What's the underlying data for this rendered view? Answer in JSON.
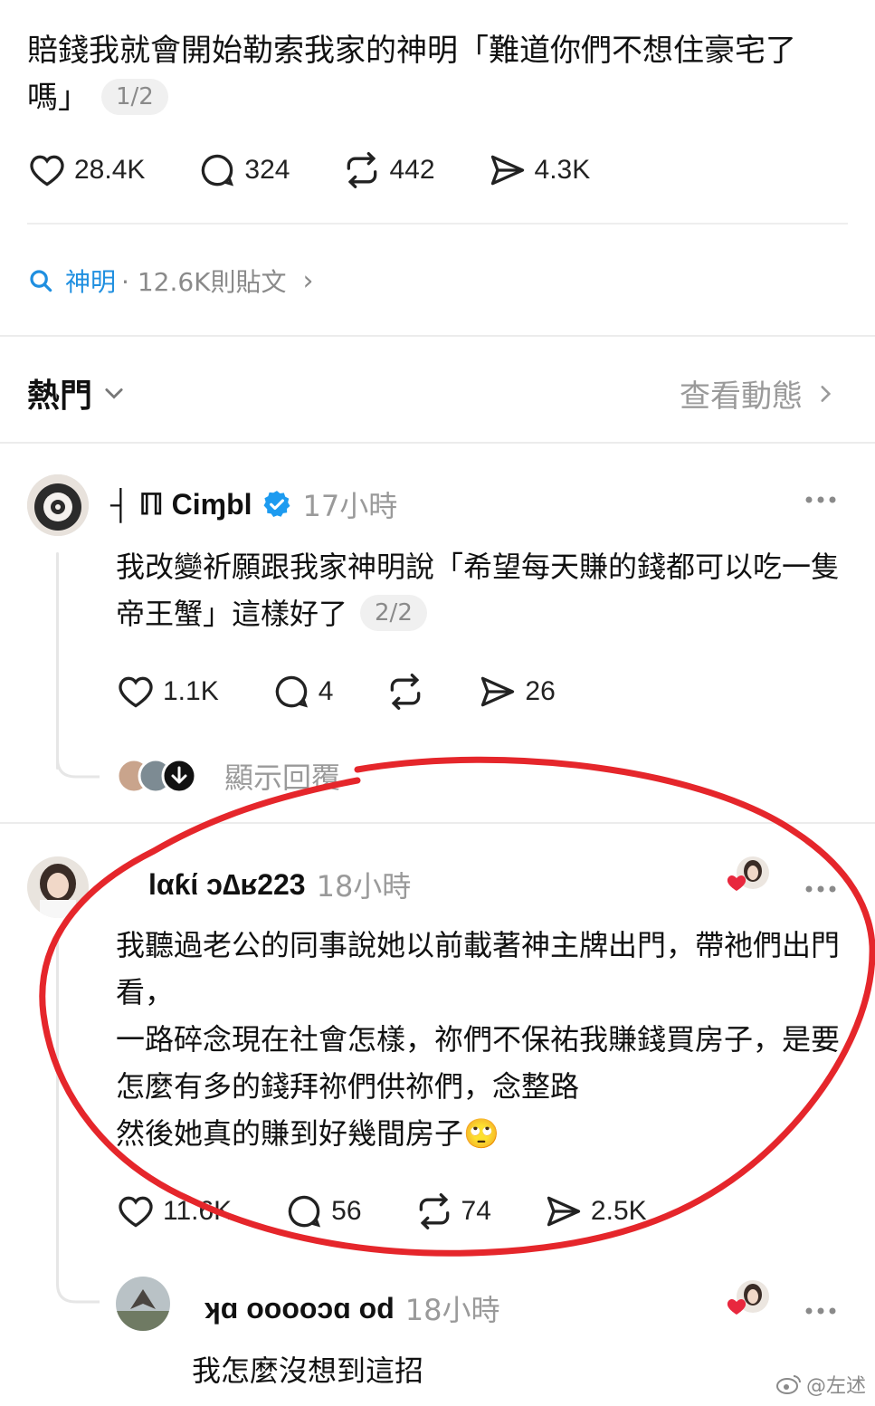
{
  "post": {
    "title": "賠錢我就會開始勒索我家的神明「難道你們不想住豪宅了嗎」",
    "page_indicator": "1/2",
    "likes": "28.4K",
    "comments": "324",
    "reposts": "442",
    "shares": "4.3K"
  },
  "topic": {
    "name": "神明",
    "count": "· 12.6K則貼文",
    "chevron": "›"
  },
  "feed": {
    "sort_label": "熱門",
    "view_activity": "查看動態"
  },
  "replies": [
    {
      "username": "┤ ℿ Ciɱbl",
      "time": "17小時",
      "text": "我改變祈願跟我家神明說「希望每天賺的錢都可以吃一隻帝王蟹」這樣好了",
      "page_indicator": "2/2",
      "likes": "1.1K",
      "comments": "4",
      "shares": "26",
      "show_replies": "顯示回覆"
    },
    {
      "username": "lαƙί ᴐ∆ʁ223",
      "time": "18小時",
      "text_lines": [
        "我聽過老公的同事說她以前載著神主牌出門，帶祂們出門看，",
        "一路碎念現在社會怎樣，祢們不保祐我賺錢買房子，是要怎麼有多的錢拜祢們供祢們，念整路",
        "然後她真的賺到好幾間房子"
      ],
      "emoji": "🙄",
      "likes": "11.6K",
      "comments": "56",
      "reposts": "74",
      "shares": "2.5K"
    },
    {
      "username": "ʞɑ ooooɔɑ od",
      "time": "18小時",
      "text": "我怎麼沒想到這招"
    }
  ],
  "watermark": "@左述",
  "colors": {
    "accent_blue": "#1f8fe0",
    "verified_blue": "#1d9bf0",
    "annotation_red": "#e5262b",
    "muted_gray": "#9a9a9a"
  }
}
